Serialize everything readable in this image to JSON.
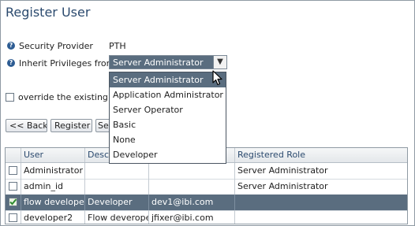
{
  "page": {
    "title": "Register User"
  },
  "form": {
    "security_provider_label": "Security Provider",
    "security_provider_value": "PTH",
    "inherit_label": "Inherit Privileges from",
    "inherit_selected": "Server Administrator",
    "override_label": "override the existing re"
  },
  "dropdown": {
    "options": [
      "Server Administrator",
      "Application Administrator",
      "Server Operator",
      "Basic",
      "None",
      "Developer"
    ],
    "highlighted_index": 0
  },
  "buttons": {
    "back": "<< Back",
    "register": "Register",
    "third_partial": "Se"
  },
  "table": {
    "headers": [
      "User",
      "Descr",
      "",
      "Registered Role"
    ],
    "rows": [
      {
        "user": "Administrator",
        "description": "",
        "email": "",
        "role": "Server Administrator",
        "checked": false,
        "selected": false
      },
      {
        "user": "admin_id",
        "description": "",
        "email": "",
        "role": "Server Administrator",
        "checked": false,
        "selected": false
      },
      {
        "user": "flow developer",
        "description": "Developer",
        "email": "dev1@ibi.com",
        "role": "",
        "checked": true,
        "selected": true
      },
      {
        "user": "developer2",
        "description": "Flow deveroper",
        "email": "jfixer@ibi.com",
        "role": "",
        "checked": false,
        "selected": false
      }
    ]
  },
  "icons": {
    "help": "help-icon",
    "dropdown_arrow": "chevron-down-icon",
    "checkmark": "checkmark-icon",
    "cursor": "mouse-pointer-icon"
  },
  "colors": {
    "title": "#2b4a6e",
    "selection": "#5a6d7f",
    "help_icon": "#2d5c93",
    "check": "#2e8b2e"
  }
}
